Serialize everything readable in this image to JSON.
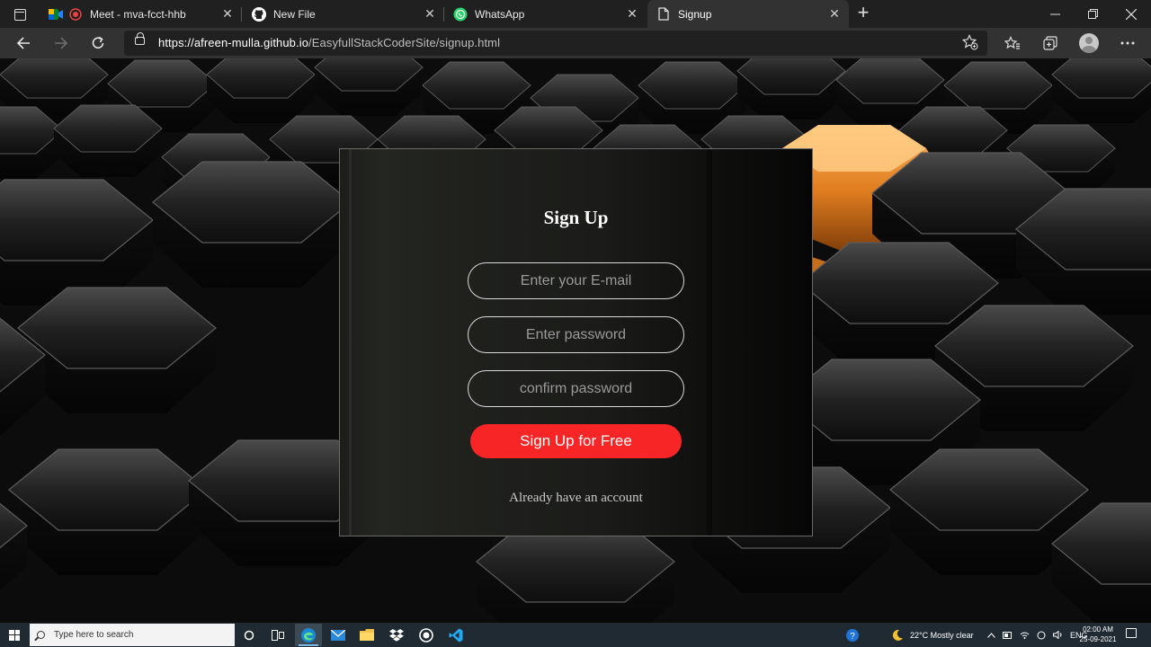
{
  "browser": {
    "tabs": [
      {
        "label": "Meet - mva-fcct-hhb",
        "icon": "google-meet-icon",
        "active": false
      },
      {
        "label": "New File",
        "icon": "github-icon",
        "active": false
      },
      {
        "label": "WhatsApp",
        "icon": "whatsapp-icon",
        "active": false
      },
      {
        "label": "Signup",
        "icon": "page-icon",
        "active": true
      }
    ],
    "tab_close_glyph": "✕",
    "new_tab_glyph": "+",
    "address": {
      "scheme": "https://",
      "host": "afreen-mulla.github.io",
      "path": "/EasyfullStackCoderSite/signup.html"
    }
  },
  "signup": {
    "title": "Sign Up",
    "email_placeholder": "Enter your E-mail",
    "password_placeholder": "Enter password",
    "confirm_placeholder": "confirm password",
    "submit_label": "Sign Up for Free",
    "login_link": "Already have an account"
  },
  "colors": {
    "accent": "#f72525",
    "highlight_orange": "#ff9a3c"
  },
  "taskbar": {
    "search_placeholder": "Type here to search",
    "weather": "22°C  Mostly clear",
    "language": "ENG",
    "time": "02:00 AM",
    "date": "25-09-2021"
  }
}
